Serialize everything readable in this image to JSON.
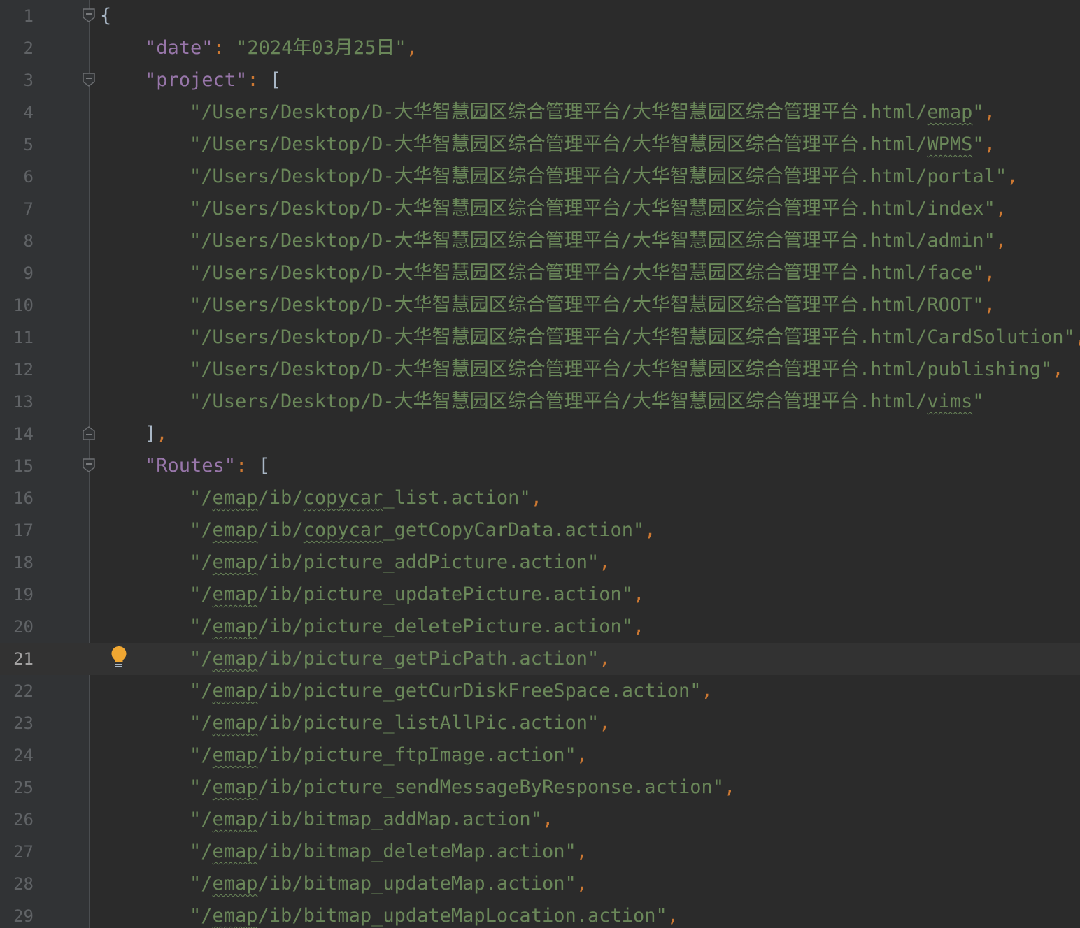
{
  "editor": {
    "current_line": 21,
    "lines": [
      {
        "n": "1"
      },
      {
        "n": "2"
      },
      {
        "n": "3"
      },
      {
        "n": "4"
      },
      {
        "n": "5"
      },
      {
        "n": "6"
      },
      {
        "n": "7"
      },
      {
        "n": "8"
      },
      {
        "n": "9"
      },
      {
        "n": "10"
      },
      {
        "n": "11"
      },
      {
        "n": "12"
      },
      {
        "n": "13"
      },
      {
        "n": "14"
      },
      {
        "n": "15"
      },
      {
        "n": "16"
      },
      {
        "n": "17"
      },
      {
        "n": "18"
      },
      {
        "n": "19"
      },
      {
        "n": "20"
      },
      {
        "n": "21"
      },
      {
        "n": "22"
      },
      {
        "n": "23"
      },
      {
        "n": "24"
      },
      {
        "n": "25"
      },
      {
        "n": "26"
      },
      {
        "n": "27"
      },
      {
        "n": "28"
      },
      {
        "n": "29"
      }
    ]
  },
  "json": {
    "open_brace": "{",
    "date_key": "\"date\"",
    "date_value": "\"2024年03月25日\"",
    "project_key": "\"project\"",
    "routes_key": "\"Routes\"",
    "colon": ": ",
    "comma": ",",
    "open_bracket": "[",
    "close_bracket": "]",
    "path_prefix": "\"/Users/Desktop/D-大华智慧园区综合管理平台/大华智慧园区综合管理平台.html/",
    "quote": "\"",
    "project": [
      "emap",
      "WPMS",
      "portal",
      "index",
      "admin",
      "face",
      "ROOT",
      "CardSolution",
      "publishing",
      "vims"
    ],
    "route_prefix_open": "\"/",
    "route_emap": "emap",
    "route_ib": "/ib/",
    "routes": [
      "copycar_list.action",
      "copycar_getCopyCarData.action",
      "picture_addPicture.action",
      "picture_updatePicture.action",
      "picture_deletePicture.action",
      "picture_getPicPath.action",
      "picture_getCurDiskFreeSpace.action",
      "picture_listAllPic.action",
      "picture_ftpImage.action",
      "picture_sendMessageByResponse.action",
      "bitmap_addMap.action",
      "bitmap_deleteMap.action",
      "bitmap_updateMap.action",
      "bitmap_updateMapLocation.action"
    ]
  },
  "colors": {
    "background": "#2b2b2b",
    "gutter": "#313335",
    "key": "#9876aa",
    "string": "#6a8759",
    "punctuation": "#cc7832",
    "bulb": "#f0a732"
  },
  "icons": [
    "fold-marker-icon",
    "lightbulb-icon"
  ]
}
